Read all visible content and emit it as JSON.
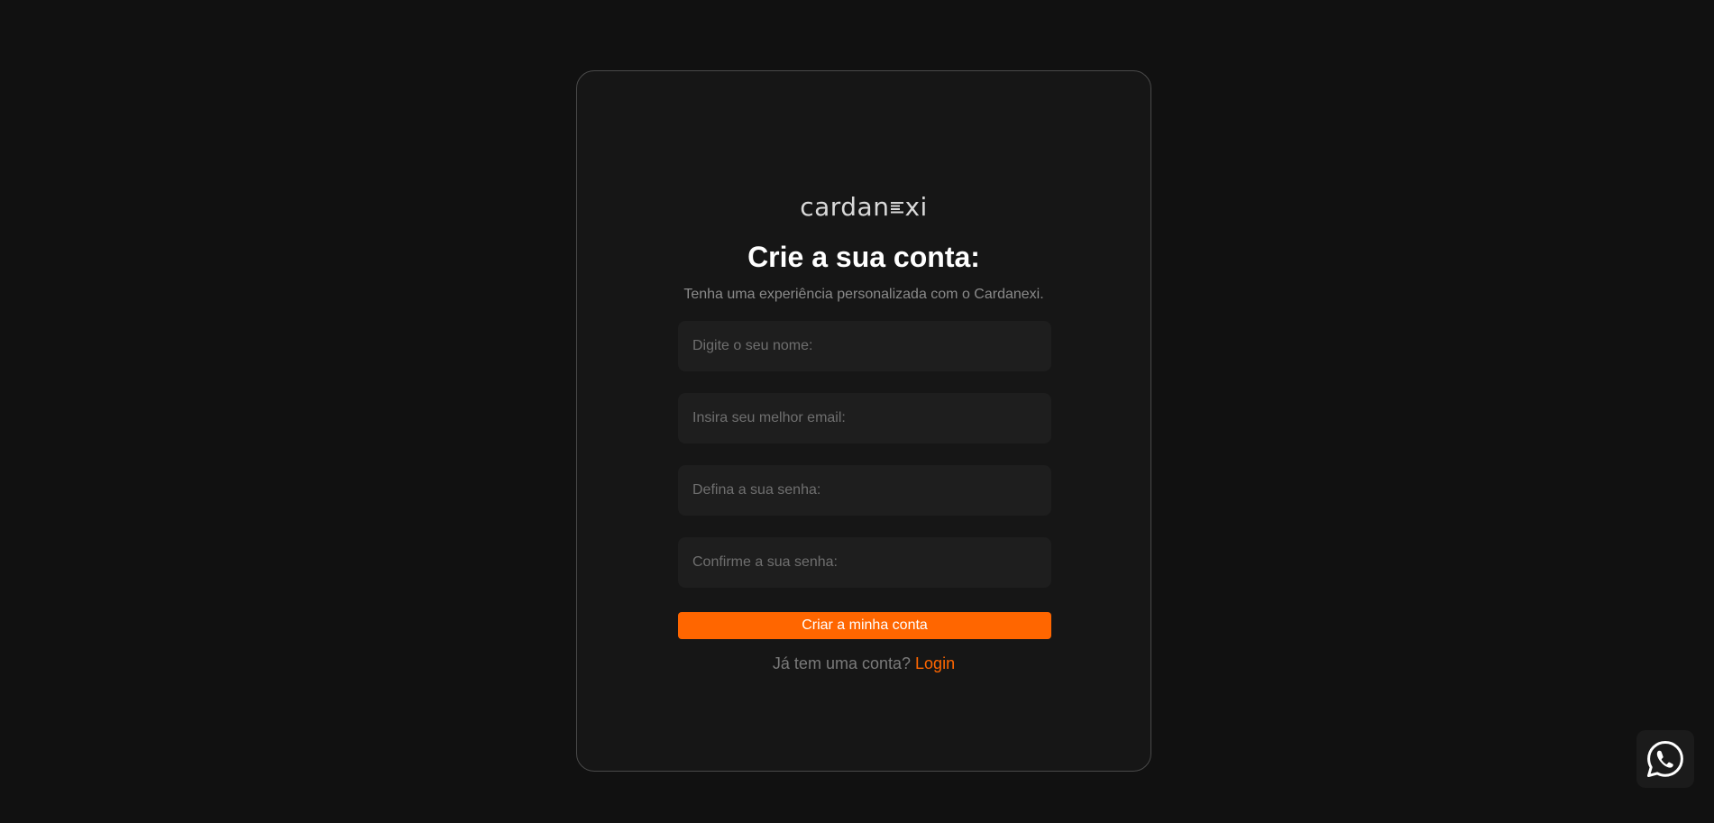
{
  "brand": {
    "logo_left": "cardan",
    "logo_right": "xi",
    "logo_mark": "lines-e-mark"
  },
  "signup": {
    "title": "Crie a sua conta:",
    "subtitle": "Tenha uma experiência personalizada com o Cardanexi.",
    "fields": {
      "name": {
        "placeholder": "Digite o seu nome:",
        "value": ""
      },
      "email": {
        "placeholder": "Insira seu melhor email:",
        "value": ""
      },
      "password": {
        "placeholder": "Defina a sua senha:",
        "value": ""
      },
      "confirm_password": {
        "placeholder": "Confirme a sua senha:",
        "value": ""
      }
    },
    "submit_label": "Criar a minha conta",
    "login_prompt": "Já tem uma conta?",
    "login_link": "Login"
  },
  "floating": {
    "whatsapp_icon": "whatsapp-icon"
  },
  "colors": {
    "background": "#111111",
    "card": "#161616",
    "accent": "#ff6600",
    "input_bg": "#1e1e1e"
  }
}
